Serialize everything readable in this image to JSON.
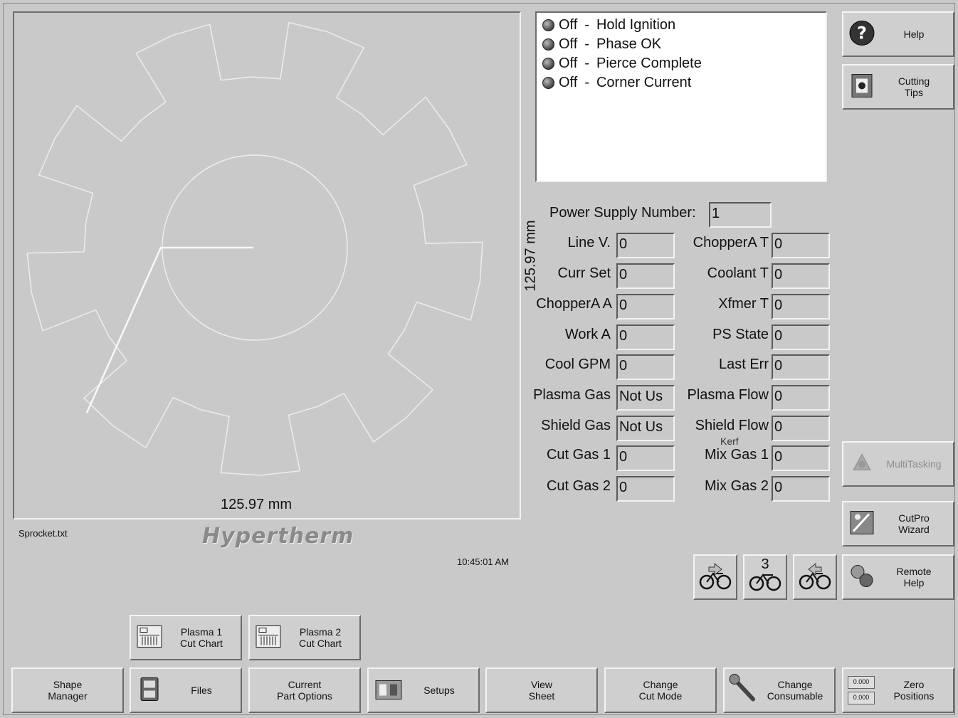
{
  "canvas": {
    "file_name": "Sprocket.txt",
    "width_dim": "125.97 mm",
    "height_dim": "125.97 mm",
    "clock": "10:45:01 AM",
    "logo": "Hypertherm"
  },
  "status": [
    {
      "state": "Off",
      "sep": "-",
      "label": "Hold Ignition"
    },
    {
      "state": "Off",
      "sep": "-",
      "label": "Phase OK"
    },
    {
      "state": "Off",
      "sep": "-",
      "label": "Pierce Complete"
    },
    {
      "state": "Off",
      "sep": "-",
      "label": "Corner Current"
    }
  ],
  "power_supply": {
    "label": "Power Supply Number:",
    "value": "1"
  },
  "left_fields": [
    {
      "label": "Line V.",
      "value": "0"
    },
    {
      "label": "Curr Set",
      "value": "0"
    },
    {
      "label": "ChopperA A",
      "value": "0"
    },
    {
      "label": "Work A",
      "value": "0"
    },
    {
      "label": "Cool GPM",
      "value": "0"
    },
    {
      "label": "Plasma Gas",
      "value": "Not Us"
    },
    {
      "label": "Shield Gas",
      "value": "Not Us"
    },
    {
      "label": "Cut Gas 1",
      "value": "0"
    },
    {
      "label": "Cut Gas 2",
      "value": "0"
    }
  ],
  "right_fields": [
    {
      "label": "ChopperA T",
      "value": "0"
    },
    {
      "label": "Coolant T",
      "value": "0"
    },
    {
      "label": "Xfmer T",
      "value": "0"
    },
    {
      "label": "PS State",
      "value": "0"
    },
    {
      "label": "Last Err",
      "value": "0"
    },
    {
      "label": "Plasma Flow",
      "value": "0"
    },
    {
      "label": "Shield Flow",
      "value": "0"
    },
    {
      "label": "Mix Gas 1",
      "value": "0"
    },
    {
      "label": "Mix Gas 2",
      "value": "0"
    }
  ],
  "kerf_label": "Kerf",
  "side_buttons": {
    "help": "Help",
    "cutting_tips": "Cutting\nTips",
    "multitasking": "MultiTasking",
    "cutpro_wizard": "CutPro\nWizard",
    "remote_help": "Remote\nHelp"
  },
  "nav_buttons": {
    "middle_number": "3"
  },
  "cut_chart_buttons": {
    "plasma1": "Plasma 1\nCut Chart",
    "plasma2": "Plasma 2\nCut Chart"
  },
  "bottom_buttons": {
    "shape_manager": "Shape\nManager",
    "files": "Files",
    "current_part_options": "Current\nPart Options",
    "setups": "Setups",
    "view_sheet": "View\nSheet",
    "change_cut_mode": "Change\nCut Mode",
    "change_consumable": "Change\nConsumable",
    "zero_positions": "Zero\nPositions",
    "zero_x": "0.000",
    "zero_y": "0.000"
  }
}
